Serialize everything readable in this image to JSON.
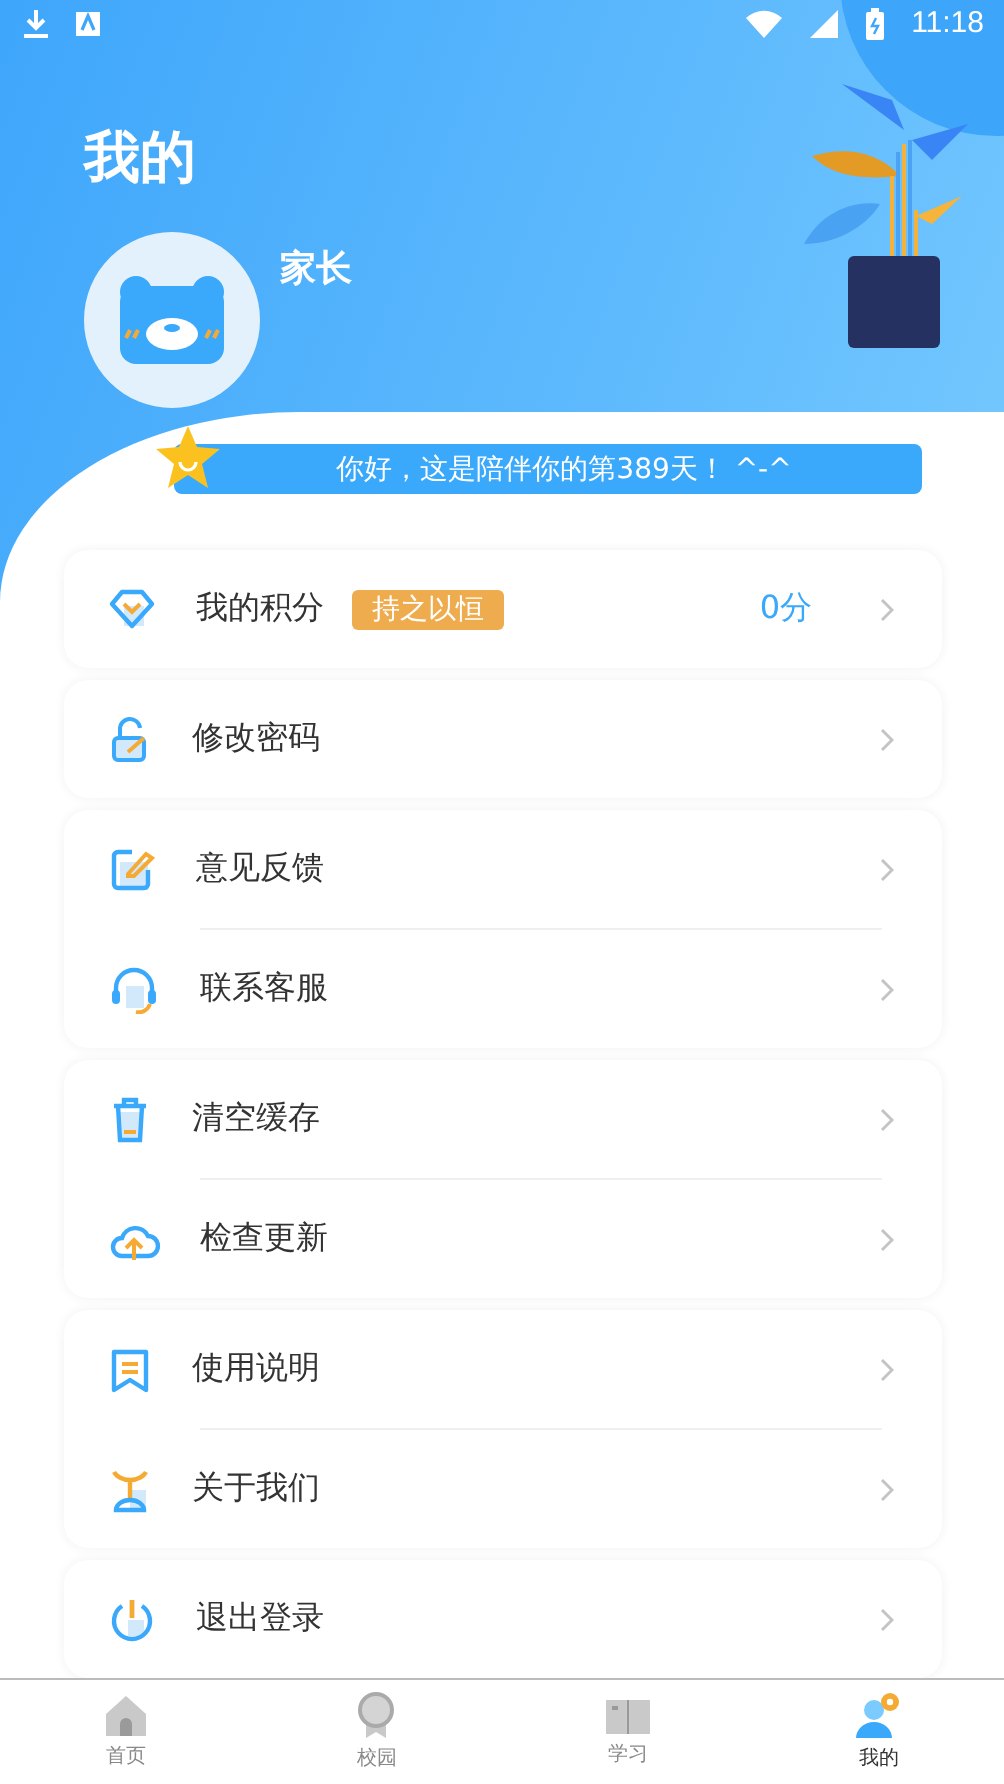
{
  "status_bar": {
    "time": "11:18"
  },
  "header": {
    "title": "我的",
    "user_name": "家长",
    "greeting": "你好，这是陪伴你的第389天！ ^-^"
  },
  "menu_groups": [
    {
      "items": [
        {
          "label": "我的积分",
          "badge": "持之以恒",
          "value": "0分"
        }
      ]
    },
    {
      "items": [
        {
          "label": "修改密码"
        }
      ]
    },
    {
      "items": [
        {
          "label": "意见反馈"
        },
        {
          "label": "联系客服"
        }
      ]
    },
    {
      "items": [
        {
          "label": "清空缓存"
        },
        {
          "label": "检查更新"
        }
      ]
    },
    {
      "items": [
        {
          "label": "使用说明"
        },
        {
          "label": "关于我们"
        }
      ]
    },
    {
      "items": [
        {
          "label": "退出登录"
        }
      ]
    }
  ],
  "tab_bar": [
    {
      "label": "首页",
      "selected": false
    },
    {
      "label": "校园",
      "selected": false
    },
    {
      "label": "学习",
      "selected": false
    },
    {
      "label": "我的",
      "selected": true
    }
  ]
}
